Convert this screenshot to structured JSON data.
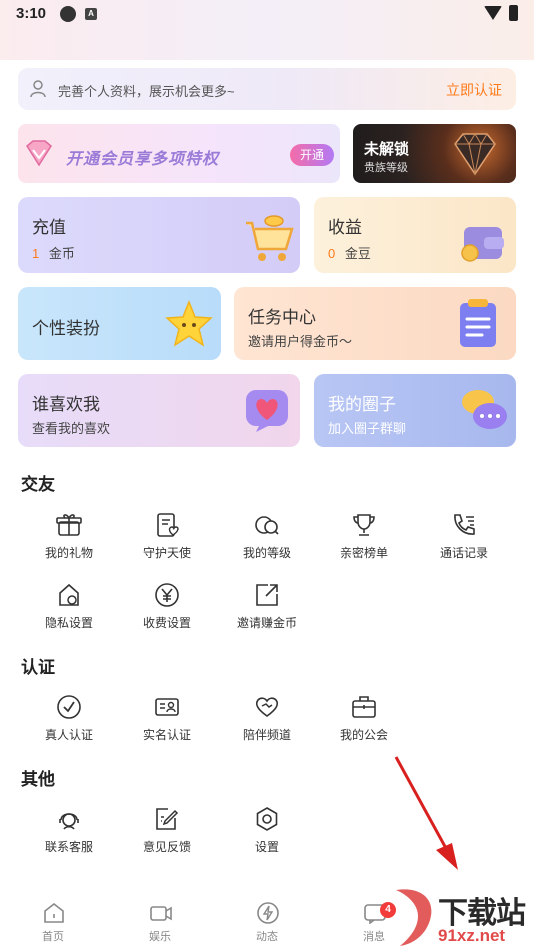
{
  "status_bar": {
    "time": "3:10",
    "app_icon_letter": "A"
  },
  "profile_banner": {
    "text": "完善个人资料，展示机会更多~",
    "action": "立即认证"
  },
  "vip_card": {
    "title": "开通会员享多项特权",
    "button": "开通"
  },
  "rank_card": {
    "title": "未解锁",
    "subtitle": "贵族等级"
  },
  "cards": {
    "recharge": {
      "title": "充值",
      "amount": "1",
      "unit": "金币"
    },
    "income": {
      "title": "收益",
      "amount": "0",
      "unit": "金豆"
    },
    "dressup": {
      "title": "个性装扮"
    },
    "tasks": {
      "title": "任务中心",
      "subtitle": "邀请用户得金币～"
    },
    "likes": {
      "title": "谁喜欢我",
      "subtitle": "查看我的喜欢"
    },
    "circle": {
      "title": "我的圈子",
      "subtitle": "加入圈子群聊"
    }
  },
  "sections": {
    "social": {
      "title": "交友",
      "items": [
        {
          "label": "我的礼物",
          "icon": "gift-icon"
        },
        {
          "label": "守护天使",
          "icon": "guardian-icon"
        },
        {
          "label": "我的等级",
          "icon": "level-icon"
        },
        {
          "label": "亲密榜单",
          "icon": "trophy-icon"
        },
        {
          "label": "通话记录",
          "icon": "call-log-icon"
        },
        {
          "label": "隐私设置",
          "icon": "privacy-icon"
        },
        {
          "label": "收费设置",
          "icon": "yuan-icon"
        },
        {
          "label": "邀请赚金币",
          "icon": "invite-icon"
        }
      ]
    },
    "verify": {
      "title": "认证",
      "items": [
        {
          "label": "真人认证",
          "icon": "check-circle-icon"
        },
        {
          "label": "实名认证",
          "icon": "id-card-icon"
        },
        {
          "label": "陪伴频道",
          "icon": "handshake-icon"
        },
        {
          "label": "我的公会",
          "icon": "guild-icon"
        }
      ]
    },
    "other": {
      "title": "其他",
      "items": [
        {
          "label": "联系客服",
          "icon": "support-icon"
        },
        {
          "label": "意见反馈",
          "icon": "feedback-icon"
        },
        {
          "label": "设置",
          "icon": "settings-icon"
        }
      ]
    }
  },
  "bottom_nav": {
    "items": [
      {
        "label": "首页",
        "icon": "home-icon"
      },
      {
        "label": "娱乐",
        "icon": "video-icon"
      },
      {
        "label": "动态",
        "icon": "lightning-icon"
      },
      {
        "label": "消息",
        "icon": "message-icon"
      }
    ],
    "message_badge": "4"
  },
  "watermark": {
    "top": "下载站",
    "bottom": "91xz.net"
  },
  "colors": {
    "accent": "#ff7a1a",
    "badge": "#f23b3b",
    "arrow": "#d8201f"
  }
}
